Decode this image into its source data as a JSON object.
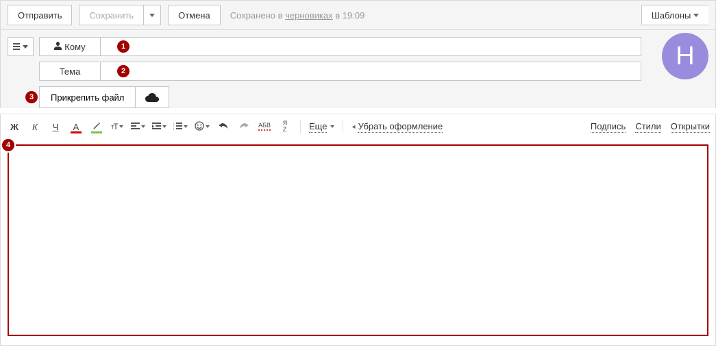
{
  "topbar": {
    "send": "Отправить",
    "save": "Сохранить",
    "cancel": "Отмена",
    "saved_prefix": "Сохранено в ",
    "drafts_word": "черновиках",
    "saved_suffix": " в 19:09",
    "templates": "Шаблоны"
  },
  "fields": {
    "to_label": "Кому",
    "subject_label": "Тема",
    "to_value": "",
    "subject_value": ""
  },
  "attach": {
    "label": "Прикрепить файл"
  },
  "avatar": {
    "initial": "Н"
  },
  "badges": {
    "to": "1",
    "subject": "2",
    "attach": "3",
    "body": "4"
  },
  "fmt": {
    "bold": "Ж",
    "italic": "К",
    "underline": "Ч",
    "font_color": "А",
    "more": "Еще",
    "remove_formatting": "Убрать оформление",
    "abc": "АБВ",
    "translit": "Я",
    "translit2": "Z"
  },
  "links": {
    "signature": "Подпись",
    "styles": "Стили",
    "postcards": "Открытки"
  },
  "body": {
    "value": ""
  }
}
